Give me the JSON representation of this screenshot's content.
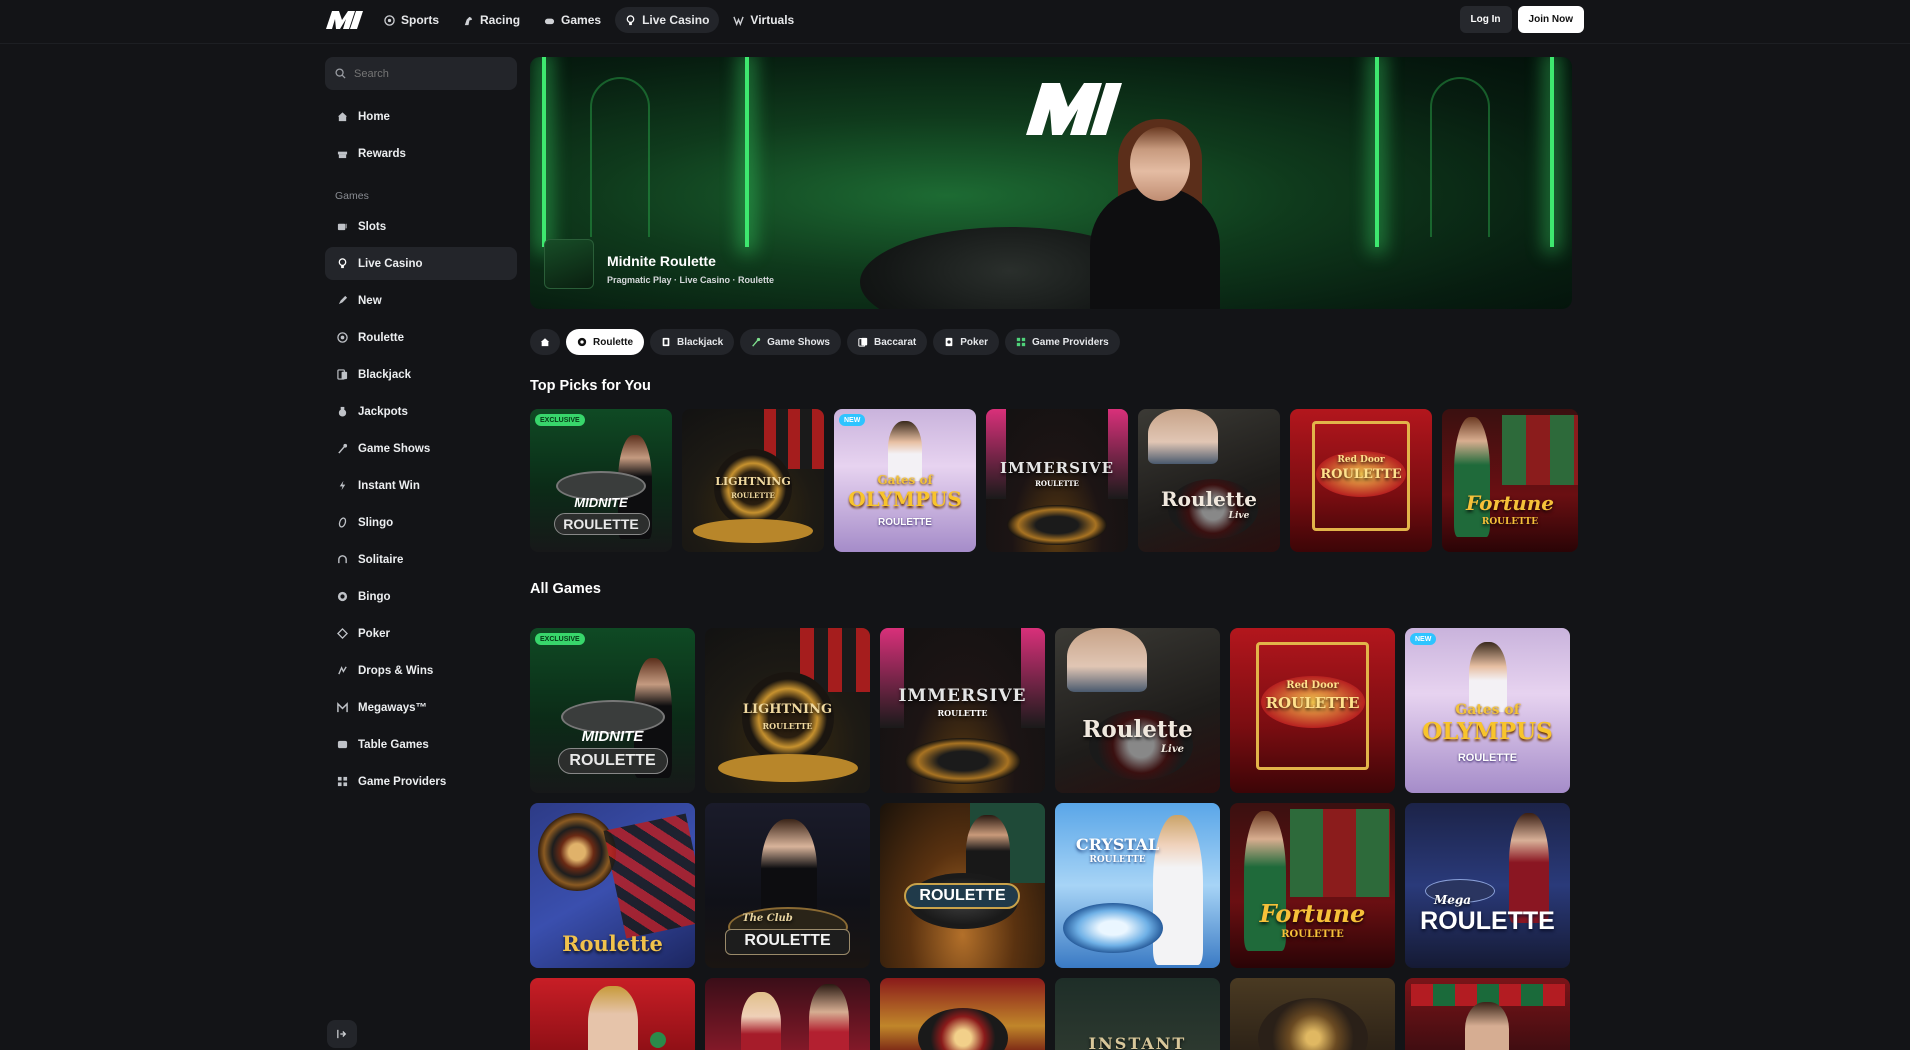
{
  "topbar": {
    "nav": [
      {
        "label": "Sports",
        "icon": "football-icon"
      },
      {
        "label": "Racing",
        "icon": "horse-icon"
      },
      {
        "label": "Games",
        "icon": "gamepad-icon"
      },
      {
        "label": "Live Casino",
        "icon": "live-icon",
        "active": true
      },
      {
        "label": "Virtuals",
        "icon": "virtuals-icon"
      }
    ],
    "login_label": "Log In",
    "join_label": "Join Now"
  },
  "sidebar": {
    "search_placeholder": "Search",
    "top_items": [
      {
        "label": "Home",
        "icon": "home-icon"
      },
      {
        "label": "Rewards",
        "icon": "gift-icon"
      }
    ],
    "games_heading": "Games",
    "game_items": [
      {
        "label": "Slots",
        "icon": "slots-icon"
      },
      {
        "label": "Live Casino",
        "icon": "live-icon",
        "active": true
      },
      {
        "label": "New",
        "icon": "rocket-icon"
      },
      {
        "label": "Roulette",
        "icon": "roulette-icon"
      },
      {
        "label": "Blackjack",
        "icon": "cards-icon"
      },
      {
        "label": "Jackpots",
        "icon": "money-bag-icon"
      },
      {
        "label": "Game Shows",
        "icon": "mic-icon"
      },
      {
        "label": "Instant Win",
        "icon": "bolt-icon"
      },
      {
        "label": "Slingo",
        "icon": "slingo-icon"
      },
      {
        "label": "Solitaire",
        "icon": "solitaire-icon"
      },
      {
        "label": "Bingo",
        "icon": "bingo-icon"
      },
      {
        "label": "Poker",
        "icon": "poker-chip-icon"
      },
      {
        "label": "Drops & Wins",
        "icon": "drops-icon"
      },
      {
        "label": "Megaways™",
        "icon": "megaways-icon"
      },
      {
        "label": "Table Games",
        "icon": "table-icon"
      },
      {
        "label": "Game Providers",
        "icon": "grid-icon"
      }
    ]
  },
  "hero": {
    "title": "Midnite Roulette",
    "subtitle": "Pragmatic Play · Live Casino · Roulette"
  },
  "chips": [
    {
      "label": "Roulette",
      "active": true
    },
    {
      "label": "Blackjack"
    },
    {
      "label": "Game Shows"
    },
    {
      "label": "Baccarat"
    },
    {
      "label": "Poker"
    },
    {
      "label": "Game Providers"
    }
  ],
  "sections": {
    "top_picks": "Top Picks for You",
    "all_games": "All Games"
  },
  "tags": {
    "exclusive": "EXCLUSIVE",
    "new": "NEW"
  },
  "tiles": {
    "midnite_top": "MIDNITE",
    "midnite_bottom": "ROULETTE",
    "lightning": "LIGHTNING",
    "lightning_sub": "ROULETTE",
    "gates_top": "Gates of",
    "gates_mid": "OLYMPUS",
    "gates_bottom": "ROULETTE",
    "immersive": "IMMERSIVE",
    "immersive_sub": "ROULETTE",
    "roulette_live": "Roulette",
    "live": "Live",
    "reddoor_top": "Red Door",
    "reddoor_bottom": "ROULETTE",
    "fortune": "Fortune",
    "fortune_sub": "ROULETTE",
    "roulette_plain": "Roulette",
    "club_script": "The Club",
    "club": "ROULETTE",
    "roulette_caps": "ROULETTE",
    "crystal": "CRYSTAL",
    "crystal_sub": "ROULETTE",
    "mega_script": "Mega",
    "mega": "ROULETTE",
    "instant": "INSTANT"
  }
}
